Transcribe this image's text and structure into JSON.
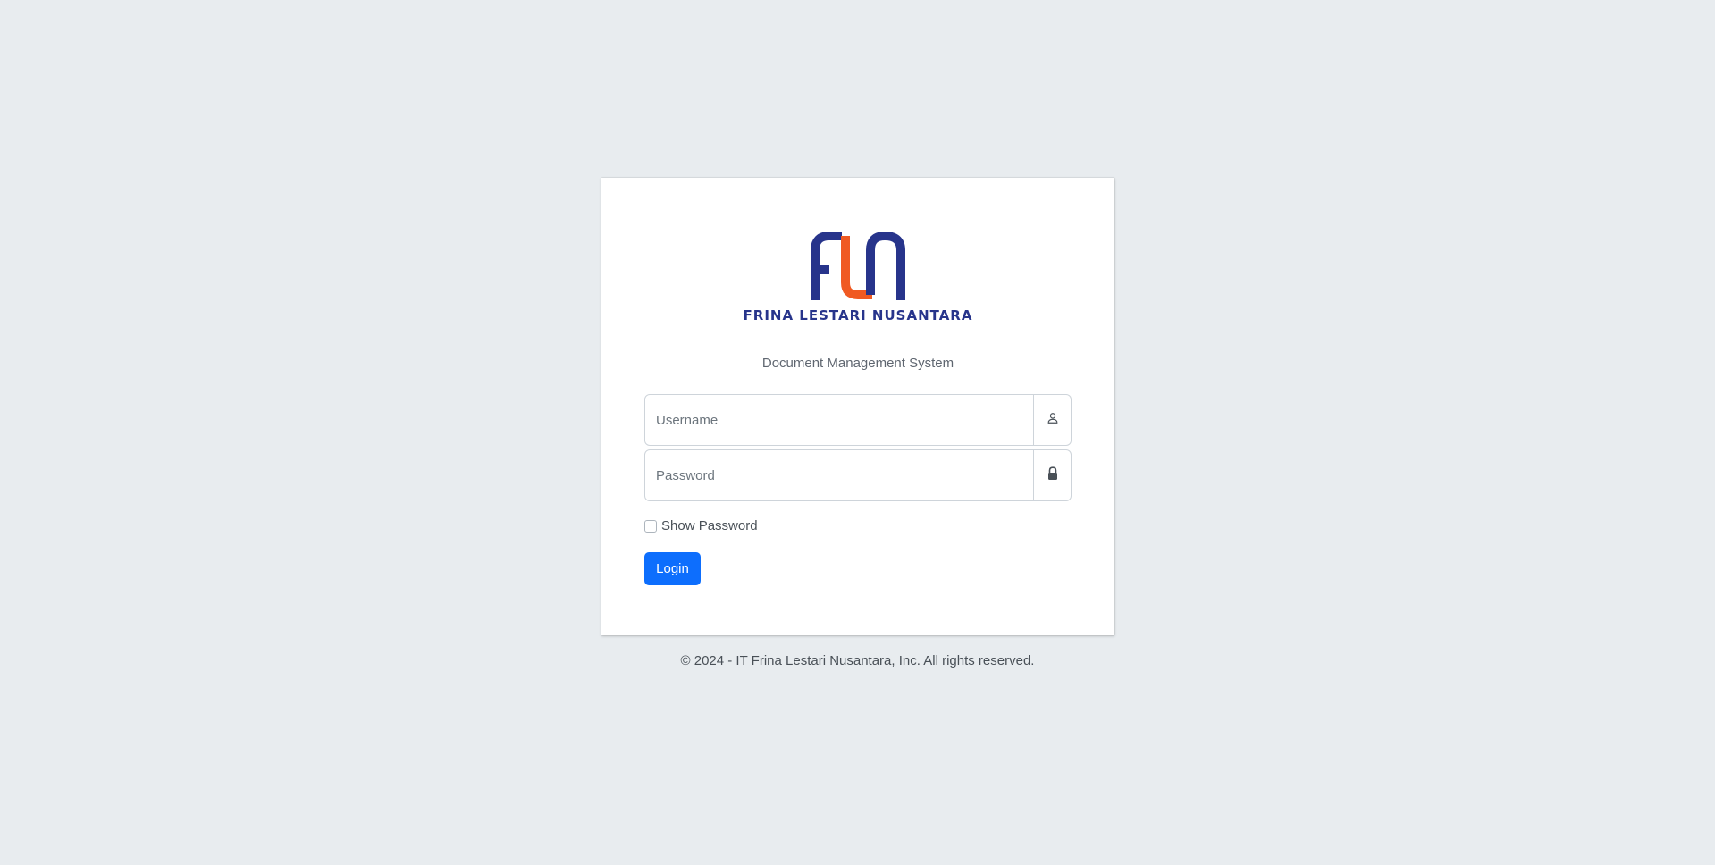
{
  "brand": {
    "logo_text": "FRINA LESTARI NUSANTARA",
    "primary_color": "#27348b",
    "accent_color": "#f05a22"
  },
  "subtitle": "Document Management System",
  "form": {
    "username_placeholder": "Username",
    "username_icon": "user-icon",
    "password_placeholder": "Password",
    "password_icon": "lock-icon",
    "show_password_label": "Show Password",
    "login_label": "Login",
    "button_color": "#0d6efd"
  },
  "footer": {
    "text": "© 2024 - IT Frina Lestari Nusantara, Inc. All rights reserved."
  }
}
